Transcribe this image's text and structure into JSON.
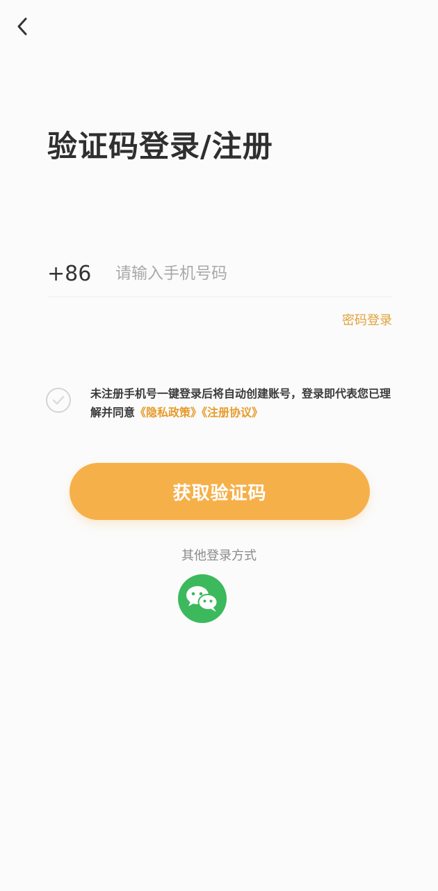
{
  "nav": {
    "back_icon": "chevron-left-icon"
  },
  "title": "验证码登录/注册",
  "phone": {
    "country_code": "+86",
    "value": "",
    "placeholder": "请输入手机号码"
  },
  "password_login_label": "密码登录",
  "agreement": {
    "checked": false,
    "checkbox_icon": "check-icon",
    "text": "未注册手机号一键登录后将自动创建账号，登录即代表您已理解并同意",
    "privacy_link": "《隐私政策》",
    "terms_link": "《注册协议》"
  },
  "get_code_button": "获取验证码",
  "other_login": {
    "label": "其他登录方式",
    "wechat_icon": "wechat-icon"
  },
  "colors": {
    "accent": "#f6b04a",
    "link": "#e79b2c",
    "wechat": "#3cb95c",
    "background": "#fbfbfb"
  }
}
